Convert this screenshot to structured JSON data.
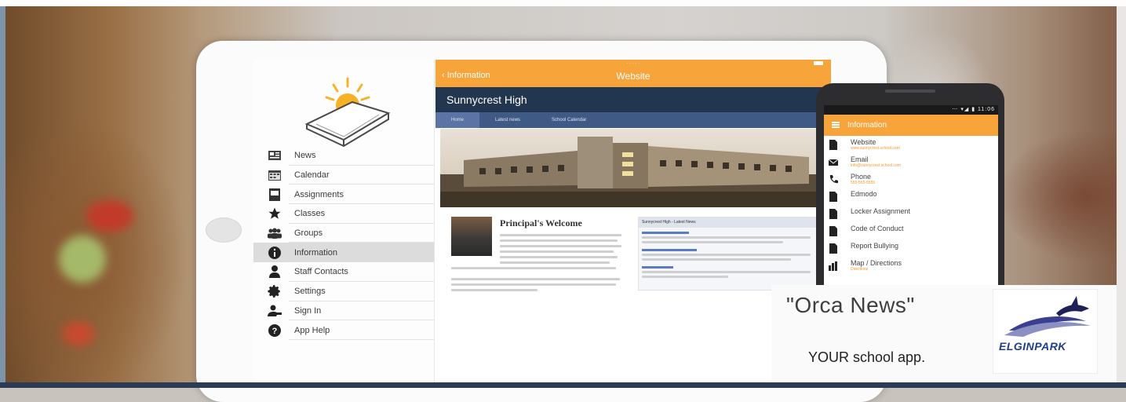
{
  "tablet": {
    "sidebar": {
      "items": [
        {
          "label": "News",
          "icon": "newspaper-icon"
        },
        {
          "label": "Calendar",
          "icon": "calendar-icon"
        },
        {
          "label": "Assignments",
          "icon": "clipboard-icon"
        },
        {
          "label": "Classes",
          "icon": "star-icon"
        },
        {
          "label": "Groups",
          "icon": "groups-icon"
        },
        {
          "label": "Information",
          "icon": "info-icon",
          "active": true
        },
        {
          "label": "Staff Contacts",
          "icon": "person-icon"
        },
        {
          "label": "Settings",
          "icon": "gear-icon"
        },
        {
          "label": "Sign In",
          "icon": "sign-in-icon"
        },
        {
          "label": "App Help",
          "icon": "help-icon"
        }
      ]
    },
    "website": {
      "back_label": "Information",
      "title": "Website",
      "school_name": "Sunnycrest High",
      "tabs": [
        "Home",
        "Latest news",
        "School Calendar"
      ],
      "welcome_title": "Principal's Welcome",
      "news_header": "Sunnycrest High - Latest News"
    }
  },
  "phone": {
    "status": "⋯ ▾◢ ▮ 11:06",
    "title": "Information",
    "items": [
      {
        "label": "Website",
        "icon": "document-icon",
        "sub": "www.sunnycrest.school.com"
      },
      {
        "label": "Email",
        "icon": "email-icon",
        "sub": "info@sunnycrest.school.com"
      },
      {
        "label": "Phone",
        "icon": "phone-icon",
        "sub": "555-555-5555"
      },
      {
        "label": "Edmodo",
        "icon": "document-icon",
        "sub": ""
      },
      {
        "label": "Locker Assignment",
        "icon": "document-icon",
        "sub": ""
      },
      {
        "label": "Code of Conduct",
        "icon": "document-icon",
        "sub": ""
      },
      {
        "label": "Report Bullying",
        "icon": "document-icon",
        "sub": ""
      },
      {
        "label": "Map / Directions",
        "icon": "map-icon",
        "sub": "Directions"
      }
    ]
  },
  "brand": {
    "tagline": "\"Orca News\"",
    "subtitle": "YOUR school app.",
    "logo_text": "ELGINPARK"
  },
  "colors": {
    "accent_orange": "#f7a43b",
    "header_navy": "#23364f",
    "tab_blue": "#405a86",
    "logo_blue": "#1f3d8a"
  }
}
